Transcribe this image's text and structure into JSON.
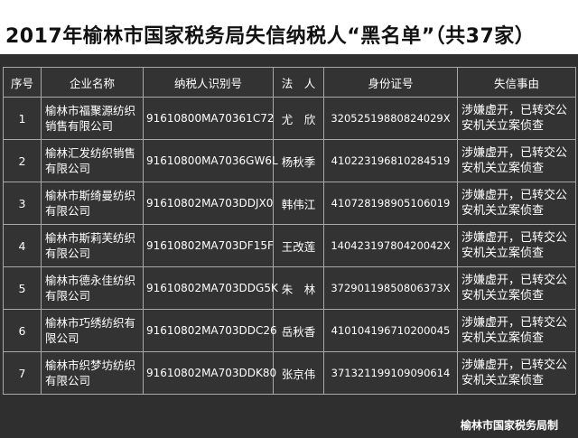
{
  "title": "2017年榆林市国家税务局失信纳税人“黑名单”（共37家）",
  "table": {
    "headers": [
      "序号",
      "企业名称",
      "纳税人识别号",
      "法　人",
      "身份证号",
      "失信事由"
    ],
    "rows": [
      {
        "idx": "1",
        "name": "榆林市福聚源纺织销售有限公司",
        "tax_id": "91610800MA70361C72",
        "person": "尤　欣",
        "id_no": "32052519880824029X",
        "reason": "涉嫌虚开，已转交公安机关立案侦查"
      },
      {
        "idx": "2",
        "name": "榆林汇发纺织销售有限公司",
        "tax_id": "91610800MA7036GW6L",
        "person": "杨秋季",
        "id_no": "410223196810284519",
        "reason": "涉嫌虚开，已转交公安机关立案侦查"
      },
      {
        "idx": "3",
        "name": "榆林市斯绮曼纺织有限公司",
        "tax_id": "91610802MA703DDJX0",
        "person": "韩伟江",
        "id_no": "410728198905106019",
        "reason": "涉嫌虚开，已转交公安机关立案侦查"
      },
      {
        "idx": "4",
        "name": "榆林市斯莉芙纺织有限公司",
        "tax_id": "91610802MA703DF15F",
        "person": "王改莲",
        "id_no": "14042319780420042X",
        "reason": "涉嫌虚开，已转交公安机关立案侦查"
      },
      {
        "idx": "5",
        "name": "榆林市德永佳纺织有限公司",
        "tax_id": "91610802MA703DDG5K",
        "person": "朱　林",
        "id_no": "37290119850806373X",
        "reason": "涉嫌虚开，已转交公安机关立案侦查"
      },
      {
        "idx": "6",
        "name": "榆林市巧绣纺织有限公司",
        "tax_id": "91610802MA703DDC26",
        "person": "岳秋香",
        "id_no": "410104196710200045",
        "reason": "涉嫌虚开，已转交公安机关立案侦查"
      },
      {
        "idx": "7",
        "name": "榆林市织梦坊纺织有限公司",
        "tax_id": "91610802MA703DDK80",
        "person": "张京伟",
        "id_no": "371321199109090614",
        "reason": "涉嫌虚开，已转交公安机关立案侦查"
      }
    ]
  },
  "footer": "榆林市国家税务局制",
  "colors": {
    "background": "#2f2f2f",
    "title_bar": "#ffffff",
    "title_text": "#111111",
    "border": "#a8a8a8",
    "text": "#ffffff"
  }
}
